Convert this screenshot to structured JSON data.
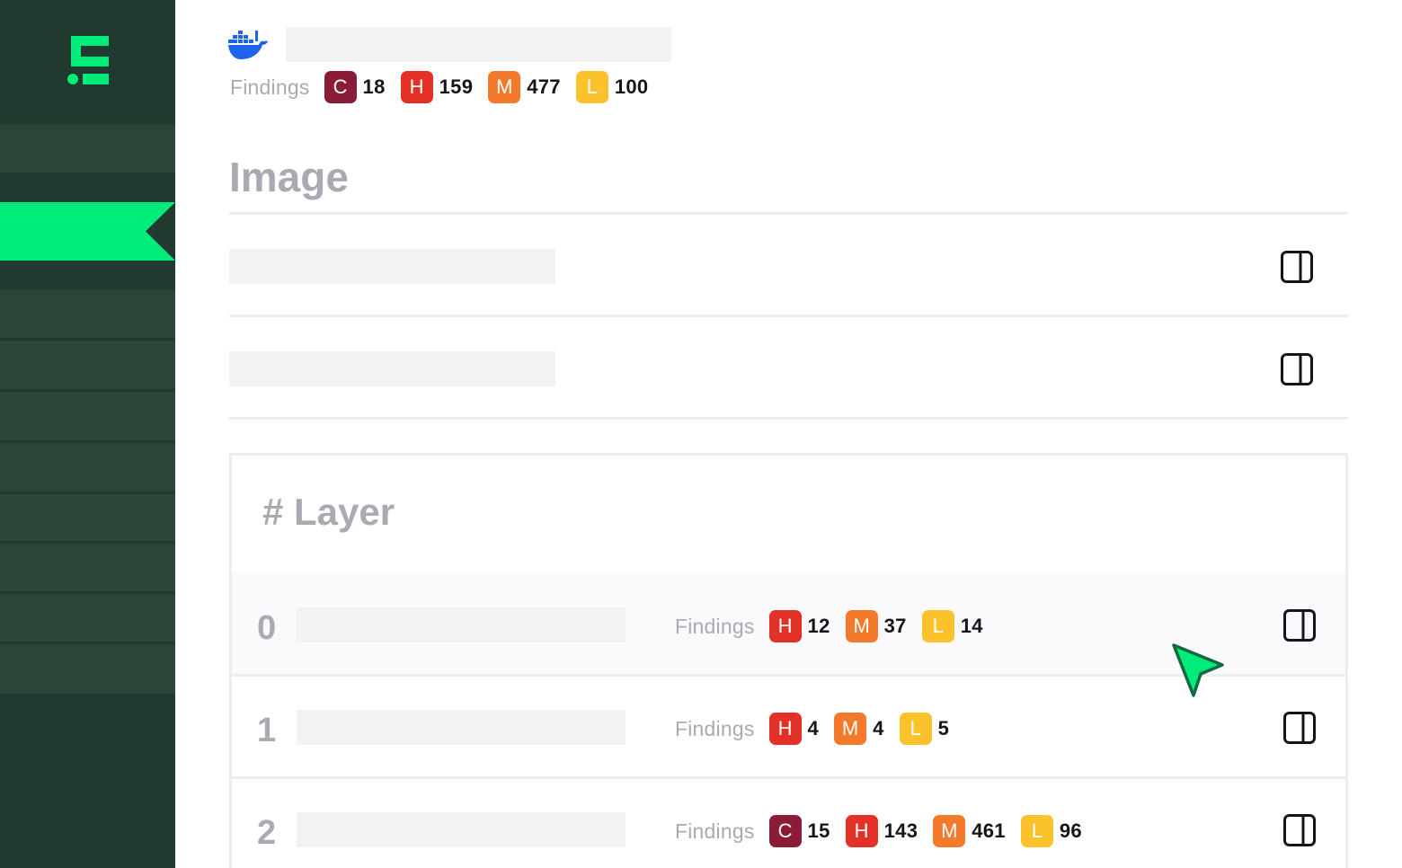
{
  "header": {
    "findings_label": "Findings",
    "findings": [
      {
        "severity": "C",
        "count": "18"
      },
      {
        "severity": "H",
        "count": "159"
      },
      {
        "severity": "M",
        "count": "477"
      },
      {
        "severity": "L",
        "count": "100"
      }
    ]
  },
  "image_section": {
    "title": "Image"
  },
  "layer_section": {
    "title": "# Layer",
    "rows": [
      {
        "index": "0",
        "findings_label": "Findings",
        "findings": [
          {
            "severity": "H",
            "count": "12"
          },
          {
            "severity": "M",
            "count": "37"
          },
          {
            "severity": "L",
            "count": "14"
          }
        ]
      },
      {
        "index": "1",
        "findings_label": "Findings",
        "findings": [
          {
            "severity": "H",
            "count": "4"
          },
          {
            "severity": "M",
            "count": "4"
          },
          {
            "severity": "L",
            "count": "5"
          }
        ]
      },
      {
        "index": "2",
        "findings_label": "Findings",
        "findings": [
          {
            "severity": "C",
            "count": "15"
          },
          {
            "severity": "H",
            "count": "143"
          },
          {
            "severity": "M",
            "count": "461"
          },
          {
            "severity": "L",
            "count": "96"
          }
        ]
      }
    ]
  },
  "icons": {
    "logo": "brand-logo-icon",
    "registry": "docker-whale-icon",
    "panel": "side-panel-icon",
    "cursor": "pointer-cursor-icon"
  },
  "colors": {
    "sidebar_bg": "#213a2f",
    "accent": "#00ec7a",
    "critical": "#8b1c38",
    "high": "#e43128",
    "medium": "#f47a2b",
    "low": "#fbc22b"
  }
}
